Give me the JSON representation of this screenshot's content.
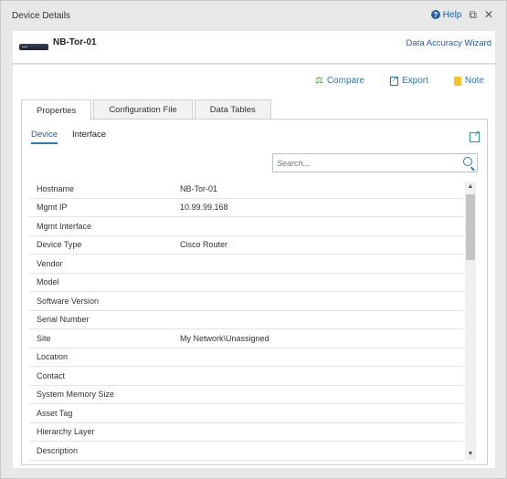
{
  "window": {
    "title": "Device Details",
    "help_label": "Help",
    "restore_icon": "restore-icon",
    "close_icon": "close-icon"
  },
  "header": {
    "device_name": "NB-Tor-01",
    "wizard_link": "Data Accuracy Wizard",
    "device_icon": "router-icon"
  },
  "actions": {
    "compare": "Compare",
    "export": "Export",
    "note": "Note"
  },
  "tabs": [
    {
      "label": "Properties",
      "active": true
    },
    {
      "label": "Configuration File",
      "active": false
    },
    {
      "label": "Data Tables",
      "active": false
    }
  ],
  "subtabs": [
    {
      "label": "Device",
      "active": true
    },
    {
      "label": "Interface",
      "active": false
    }
  ],
  "search": {
    "placeholder": "Search..."
  },
  "properties": [
    {
      "label": "Hostname",
      "value": "NB-Tor-01"
    },
    {
      "label": "Mgmt IP",
      "value": "10.99.99.168"
    },
    {
      "label": "Mgmt Interface",
      "value": ""
    },
    {
      "label": "Device Type",
      "value": "Cisco Router"
    },
    {
      "label": "Vendor",
      "value": ""
    },
    {
      "label": "Model",
      "value": ""
    },
    {
      "label": "Software Version",
      "value": ""
    },
    {
      "label": "Serial Number",
      "value": ""
    },
    {
      "label": "Site",
      "value": "My Network\\Unassigned"
    },
    {
      "label": "Location",
      "value": ""
    },
    {
      "label": "Contact",
      "value": ""
    },
    {
      "label": "System Memory Size",
      "value": ""
    },
    {
      "label": "Asset Tag",
      "value": ""
    },
    {
      "label": "Hierarchy Layer",
      "value": ""
    },
    {
      "label": "Description",
      "value": ""
    }
  ],
  "colors": {
    "link": "#1e5fa8",
    "accent": "#2a7ab0",
    "compare_icon": "#3a9b3a",
    "note_icon": "#f4c430"
  }
}
